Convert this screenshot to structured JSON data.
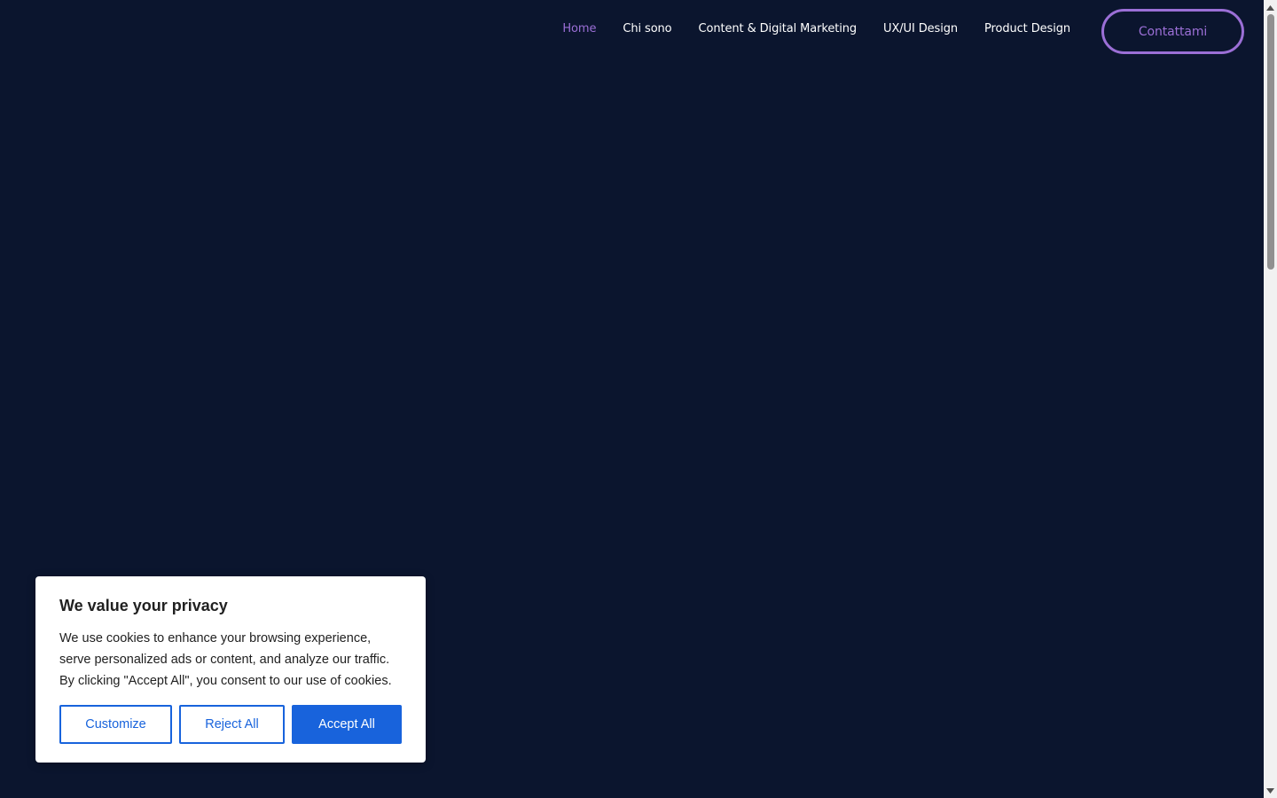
{
  "header": {
    "nav": [
      {
        "label": "Home",
        "active": true
      },
      {
        "label": "Chi sono",
        "active": false
      },
      {
        "label": "Content & Digital Marketing",
        "active": false
      },
      {
        "label": "UX/UI Design",
        "active": false
      },
      {
        "label": "Product Design",
        "active": false
      }
    ],
    "cta_label": "Contattami"
  },
  "cookie_banner": {
    "title": "We value your privacy",
    "text": "We use cookies to enhance your browsing experience, serve personalized ads or content, and analyze our traffic. By clicking \"Accept All\", you consent to our use of cookies.",
    "customize_label": "Customize",
    "reject_label": "Reject All",
    "accept_label": "Accept All"
  },
  "icons": {
    "scroll_up": "chevron-up-icon",
    "scroll_down": "chevron-down-icon"
  },
  "colors": {
    "background": "#0b152e",
    "accent": "#9b6fd6",
    "cookie_primary": "#1863dc"
  }
}
